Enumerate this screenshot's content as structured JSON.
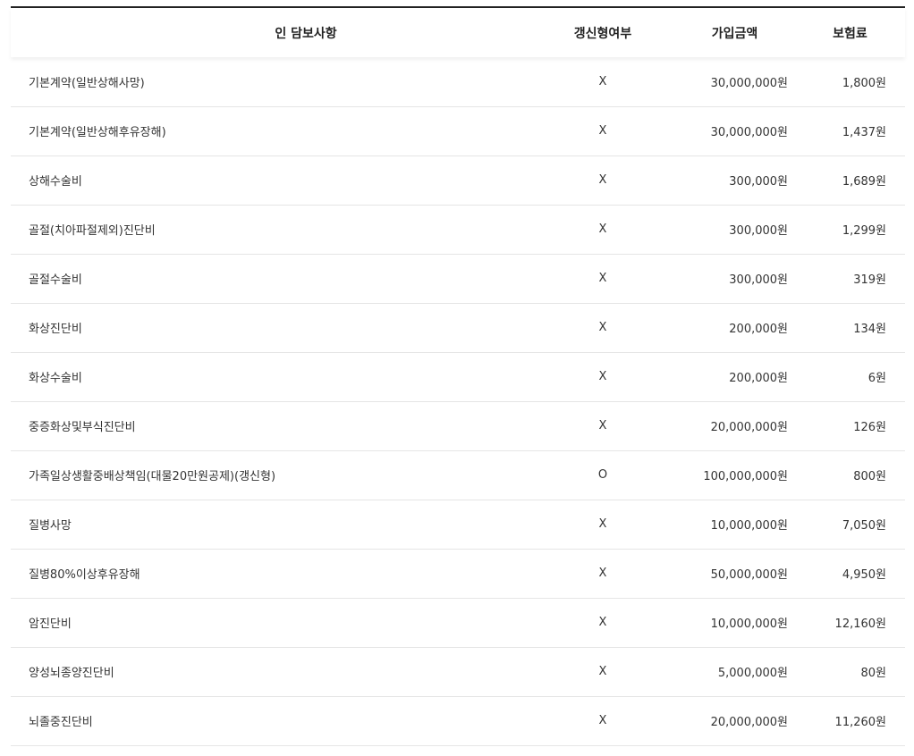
{
  "table": {
    "headers": {
      "name": "인 담보사항",
      "renew": "갱신형여부",
      "amount": "가입금액",
      "premium": "보험료"
    },
    "rows": [
      {
        "name": "기본계약(일반상해사망)",
        "renew": "X",
        "amount": "30,000,000원",
        "premium": "1,800원"
      },
      {
        "name": "기본계약(일반상해후유장해)",
        "renew": "X",
        "amount": "30,000,000원",
        "premium": "1,437원"
      },
      {
        "name": "상해수술비",
        "renew": "X",
        "amount": "300,000원",
        "premium": "1,689원"
      },
      {
        "name": "골절(치아파절제외)진단비",
        "renew": "X",
        "amount": "300,000원",
        "premium": "1,299원"
      },
      {
        "name": "골절수술비",
        "renew": "X",
        "amount": "300,000원",
        "premium": "319원"
      },
      {
        "name": "화상진단비",
        "renew": "X",
        "amount": "200,000원",
        "premium": "134원"
      },
      {
        "name": "화상수술비",
        "renew": "X",
        "amount": "200,000원",
        "premium": "6원"
      },
      {
        "name": "중증화상및부식진단비",
        "renew": "X",
        "amount": "20,000,000원",
        "premium": "126원"
      },
      {
        "name": "가족일상생활중배상책임(대물20만원공제)(갱신형)",
        "renew": "O",
        "amount": "100,000,000원",
        "premium": "800원"
      },
      {
        "name": "질병사망",
        "renew": "X",
        "amount": "10,000,000원",
        "premium": "7,050원"
      },
      {
        "name": "질병80%이상후유장해",
        "renew": "X",
        "amount": "50,000,000원",
        "premium": "4,950원"
      },
      {
        "name": "암진단비",
        "renew": "X",
        "amount": "10,000,000원",
        "premium": "12,160원"
      },
      {
        "name": "양성뇌종양진단비",
        "renew": "X",
        "amount": "5,000,000원",
        "premium": "80원"
      },
      {
        "name": "뇌졸중진단비",
        "renew": "X",
        "amount": "20,000,000원",
        "premium": "11,260원"
      }
    ]
  }
}
